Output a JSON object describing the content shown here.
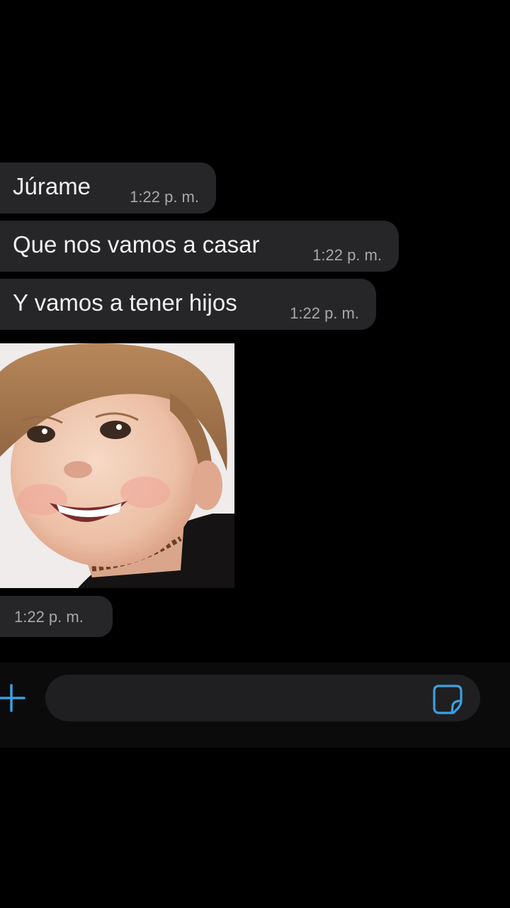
{
  "messages": [
    {
      "text": "Júrame",
      "time": "1:22 p. m."
    },
    {
      "text": "Que nos vamos a casar",
      "time": "1:22 p. m."
    },
    {
      "text": "Y vamos a tener hijos",
      "time": "1:22 p. m."
    }
  ],
  "photo_message": {
    "time": "1:22 p. m."
  },
  "composer": {
    "input_value": "",
    "icons": {
      "attach": "plus-icon",
      "sticker": "sticker-icon"
    },
    "accent_color": "#3b9fe0"
  }
}
